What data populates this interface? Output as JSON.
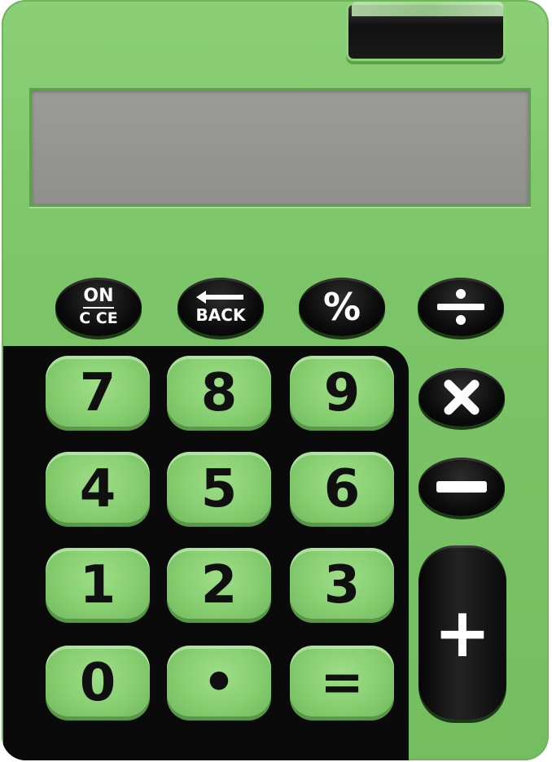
{
  "function_keys": {
    "on_top": "ON",
    "on_bottom": "C CE",
    "back": "BACK",
    "percent": "%"
  },
  "digit_keys": [
    {
      "label": "7"
    },
    {
      "label": "8"
    },
    {
      "label": "9"
    },
    {
      "label": "4"
    },
    {
      "label": "5"
    },
    {
      "label": "6"
    },
    {
      "label": "1"
    },
    {
      "label": "2"
    },
    {
      "label": "3"
    },
    {
      "label": "0"
    },
    {
      "label": "•"
    },
    {
      "label": "="
    }
  ],
  "operator_keys": {
    "divide_icon": "divide-icon",
    "multiply_icon": "multiply-icon",
    "minus_icon": "minus-icon",
    "plus": "+"
  },
  "colors": {
    "body": "#7cc568",
    "keypad_background": "#0a0a0a",
    "digit_key": "#86cd70",
    "function_key": "#0b0b0b",
    "display": "#9b9c98"
  }
}
